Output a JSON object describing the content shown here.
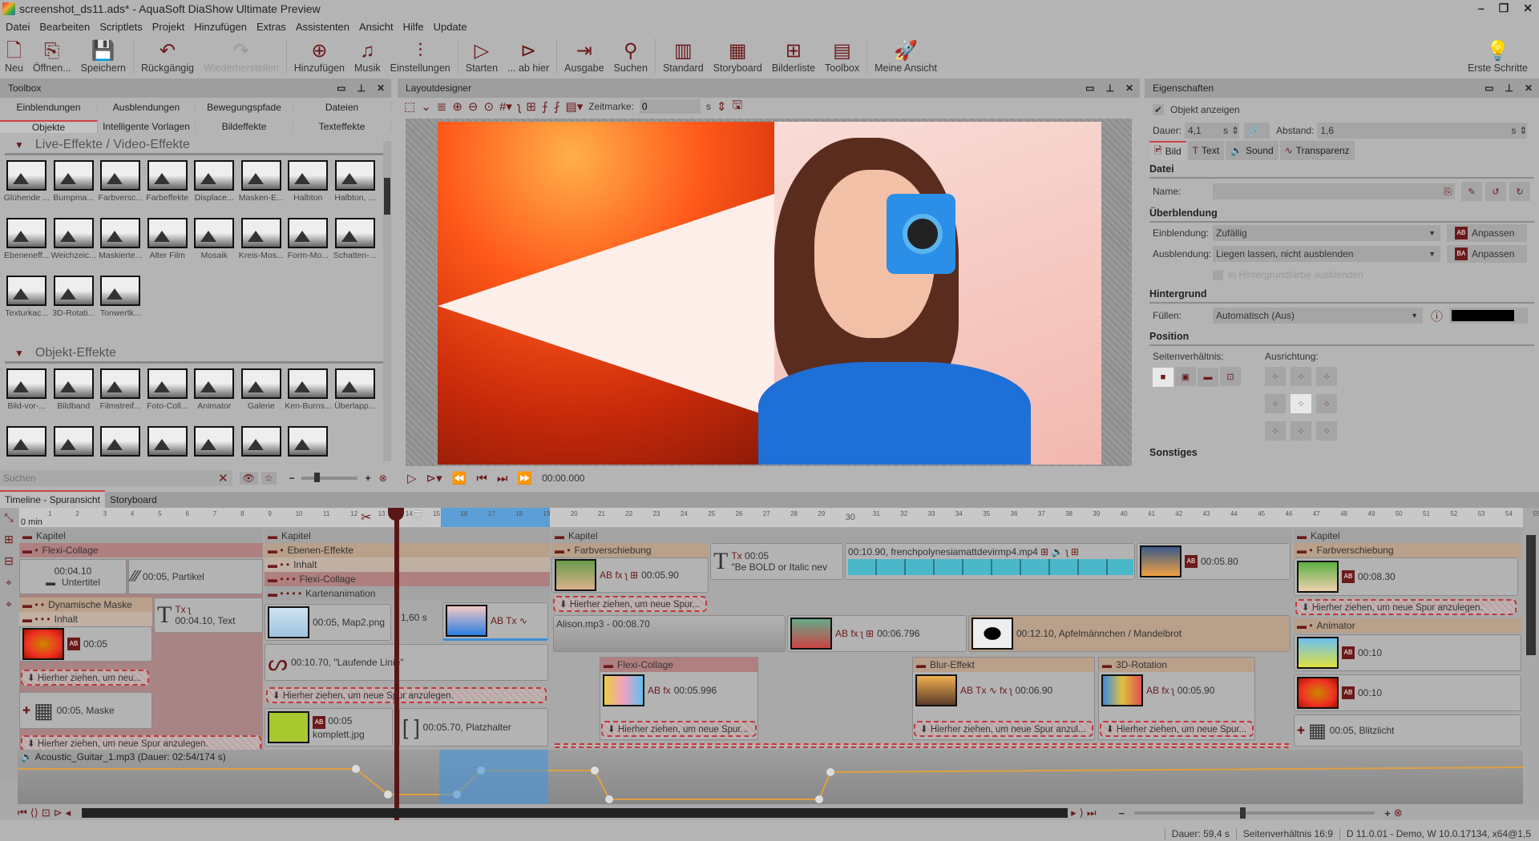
{
  "window": {
    "title": "screenshot_ds11.ads* - AquaSoft DiaShow Ultimate Preview",
    "controls": [
      "–",
      "❐",
      "✕"
    ]
  },
  "menu": [
    "Datei",
    "Bearbeiten",
    "Scriptlets",
    "Projekt",
    "Hinzufügen",
    "Extras",
    "Assistenten",
    "Ansicht",
    "Hilfe",
    "Update"
  ],
  "toolbar": [
    {
      "label": "Neu",
      "icon": "new-file-icon",
      "glyph": "🗋"
    },
    {
      "label": "Öffnen...",
      "icon": "open-icon",
      "glyph": "⎘"
    },
    {
      "label": "Speichern",
      "icon": "save-icon",
      "glyph": "💾"
    },
    {
      "label": "Rückgängig",
      "icon": "undo-icon",
      "glyph": "↶"
    },
    {
      "label": "Wiederherstellen",
      "icon": "redo-icon",
      "glyph": "↷",
      "disabled": true
    },
    {
      "label": "Hinzufügen",
      "icon": "add-icon",
      "glyph": "⊕"
    },
    {
      "label": "Musik",
      "icon": "music-icon",
      "glyph": "♫"
    },
    {
      "label": "Einstellungen",
      "icon": "settings-sliders-icon",
      "glyph": "⫶"
    },
    {
      "label": "Starten",
      "icon": "play-icon",
      "glyph": "▷"
    },
    {
      "label": "... ab hier",
      "icon": "play-from-here-icon",
      "glyph": "⊳"
    },
    {
      "label": "Ausgabe",
      "icon": "export-icon",
      "glyph": "⇥"
    },
    {
      "label": "Suchen",
      "icon": "search-icon",
      "glyph": "⚲"
    },
    {
      "label": "Standard",
      "icon": "layout-standard-icon",
      "glyph": "▥"
    },
    {
      "label": "Storyboard",
      "icon": "layout-storyboard-icon",
      "glyph": "▦"
    },
    {
      "label": "Bilderliste",
      "icon": "layout-imagelist-icon",
      "glyph": "⊞"
    },
    {
      "label": "Toolbox",
      "icon": "layout-toolbox-icon",
      "glyph": "▤"
    },
    {
      "label": "Meine Ansicht",
      "icon": "rocket-icon",
      "glyph": "🚀"
    }
  ],
  "toolbar_right": {
    "label": "Erste Schritte",
    "glyph": "💡"
  },
  "toolbox": {
    "title": "Toolbox",
    "tabs_row1": [
      "Einblendungen",
      "Ausblendungen",
      "Bewegungspfade",
      "Dateien"
    ],
    "tabs_row2": [
      "Objekte",
      "Intelligente Vorlagen",
      "Bildeffekte",
      "Texteffekte"
    ],
    "active_tab": "Objekte",
    "section1": "Live-Effekte / Video-Effekte",
    "live_effects": [
      "Glühende ...",
      "Bumpma...",
      "Farbversc...",
      "Farbeffekte",
      "Displace...",
      "Masken-E...",
      "Halbton",
      "Halbton, ...",
      "Ebeneneff...",
      "Weichzeic...",
      "Maskierte...",
      "Alter Film",
      "Mosaik",
      "Kreis-Mos...",
      "Form-Mo...",
      "Schatten-...",
      "Texturkac...",
      "3D-Rotati...",
      "Tonwertk..."
    ],
    "section2": "Objekt-Effekte",
    "object_effects": [
      "Bild-vor-...",
      "Bildband",
      "Filmstreif...",
      "Foto-Coll...",
      "Animator",
      "Galerie",
      "Ken-Burns...",
      "Überlapp...",
      "",
      "",
      "",
      "",
      "",
      "",
      ""
    ],
    "search_placeholder": "Suchen"
  },
  "layout": {
    "title": "Layoutdesigner",
    "zeitmarke_label": "Zeitmarke:",
    "zeitmarke_value": "0",
    "zeitmarke_unit": "s",
    "time": "00:00.000"
  },
  "props": {
    "title": "Eigenschaften",
    "show_object": "Objekt anzeigen",
    "dauer_label": "Dauer:",
    "dauer": "4,1",
    "unit": "s",
    "abstand_label": "Abstand:",
    "abstand": "1,6",
    "tabs": [
      "Bild",
      "Text",
      "Sound",
      "Transparenz"
    ],
    "datei": "Datei",
    "name_label": "Name:",
    "name_value": "",
    "ueberblendung": "Überblendung",
    "einblendung_label": "Einblendung:",
    "einblendung": "Zufällig",
    "ausblendung_label": "Ausblendung:",
    "ausblendung": "Liegen lassen, nicht ausblenden",
    "anpassen": "Anpassen",
    "hintergrund_check": "In Hintergrundfarbe ausblenden",
    "hintergrund": "Hintergrund",
    "fuellen_label": "Füllen:",
    "fuellen": "Automatisch (Aus)",
    "fill_color": "#000000",
    "position": "Position",
    "seitenverhaeltnis": "Seitenverhältnis:",
    "ausrichtung": "Ausrichtung:",
    "sonstiges": "Sonstiges"
  },
  "timeline": {
    "tabs": [
      "Timeline - Spuransicht",
      "Storyboard"
    ],
    "ruler_start": "0 min",
    "ruler_ticks": [
      "1",
      "2",
      "3",
      "4",
      "5",
      "6",
      "7",
      "8",
      "9",
      "10",
      "11",
      "12",
      "13",
      "14",
      "15",
      "16",
      "17",
      "18",
      "19",
      "20",
      "21",
      "22",
      "23",
      "24",
      "25",
      "26",
      "27",
      "28",
      "29",
      "30",
      "31",
      "32",
      "33",
      "34",
      "35",
      "36",
      "37",
      "38",
      "39",
      "40",
      "41",
      "42",
      "43",
      "44",
      "45",
      "46",
      "47",
      "48",
      "49",
      "50",
      "51",
      "52",
      "53",
      "54",
      "55"
    ],
    "kapitel": "Kapitel",
    "flexi": "Flexi-Collage",
    "c1_time": "00:04.10",
    "c1_name": "Untertitel",
    "c2": "00:05, Partikel",
    "dyn_maske": "Dynamische Maske",
    "inhalt": "Inhalt",
    "c3": "00:05",
    "c4_time": "00:04.10, Text",
    "drop_short": "Hierher ziehen, um neu...",
    "c5": "00:05, Maske",
    "drop_long": "Hierher ziehen, um neue Spur anzulegen.",
    "ebenen": "Ebenen-Effekte",
    "kartenanim": "Kartenanimation",
    "map": "00:05, Map2.png",
    "gap": "1,60 s",
    "linie": "00:10.70, \"Laufende Linie\"",
    "komplett_time": "00:05",
    "komplett_name": "komplett.jpg",
    "platz": "00:05.70, Platzhalter",
    "farbv": "Farbverschiebung",
    "c6": "00:05.90",
    "text2_time": "00:05",
    "text2": "\"Be BOLD or Italic nev",
    "video": "00:10.90, frenchpolynesiamattdevirmp4.mp4",
    "c7": "00:05.80",
    "drop_mid": "Hierher ziehen, um neue Spur...",
    "alison": "Alison.mp3 - 00:08.70",
    "c8": "00:06.796",
    "mandel": "00:12.10, Apfelmännchen / Mandelbrot",
    "flexi2_time": "00:05.996",
    "blur": "Blur-Effekt",
    "blur_time": "00:06.90",
    "rot3d": "3D-Rotation",
    "rot_time": "00:05.90",
    "drop_anzul": "Hierher ziehen, um neue Spur anzul...",
    "r_time1": "00:08.30",
    "animator": "Animator",
    "r_time2": "00:10",
    "r_time3": "00:10",
    "blitz": "00:05, Blitzlicht",
    "audio": "Acoustic_Guitar_1.mp3 (Dauer: 02:54/174 s)"
  },
  "status": [
    "Dauer: 59,4 s",
    "Seitenverhältnis 16:9",
    "D 11.0.01 - Demo, W 10.0.17134, x64@1,5"
  ]
}
